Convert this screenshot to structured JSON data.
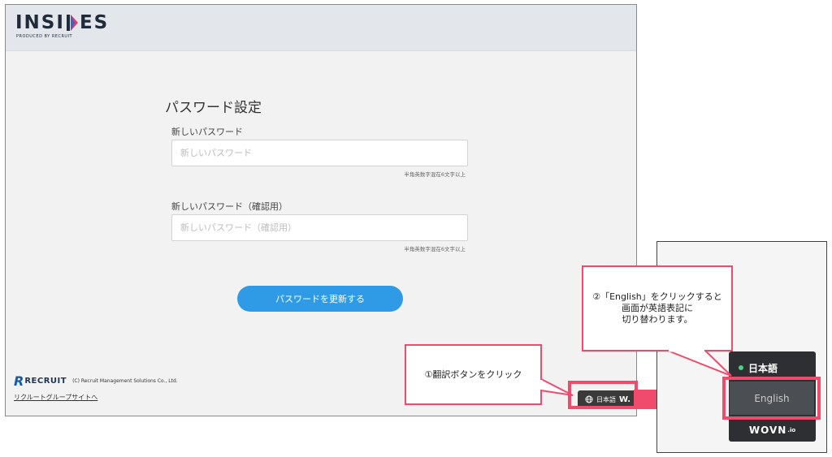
{
  "header": {
    "logo_text_left": "INSI",
    "logo_text_right": "ES",
    "logo_sub": "PRODUCED BY RECRUIT"
  },
  "form": {
    "title": "パスワード設定",
    "password_label": "新しいパスワード",
    "password_placeholder": "新しいパスワード",
    "password_hint": "半角英数字混在6文字以上",
    "confirm_label": "新しいパスワード（確認用）",
    "confirm_placeholder": "新しいパスワード（確認用）",
    "confirm_hint": "半角英数字混在6文字以上",
    "submit_label": "パスワードを更新する"
  },
  "footer": {
    "brand": "RECRUIT",
    "copyright": "(C) Recruit Management Solutions Co., Ltd.",
    "group_link": "リクルートグループサイトへ"
  },
  "wovn_widget": {
    "current_language": "日本語",
    "brand_short": "W."
  },
  "annotations": {
    "step1": "①翻訳ボタンをクリック",
    "step2_line1": "②「English」をクリックすると",
    "step2_line2": "画面が英語表記に",
    "step2_line3": "切り替わります。"
  },
  "language_menu": {
    "japanese": "日本語",
    "english": "English",
    "brand": "WOVN",
    "brand_suffix": ".io"
  },
  "colors": {
    "accent_blue": "#2f9be7",
    "annotation_red": "#f04a6d",
    "active_dot": "#4cd184"
  }
}
